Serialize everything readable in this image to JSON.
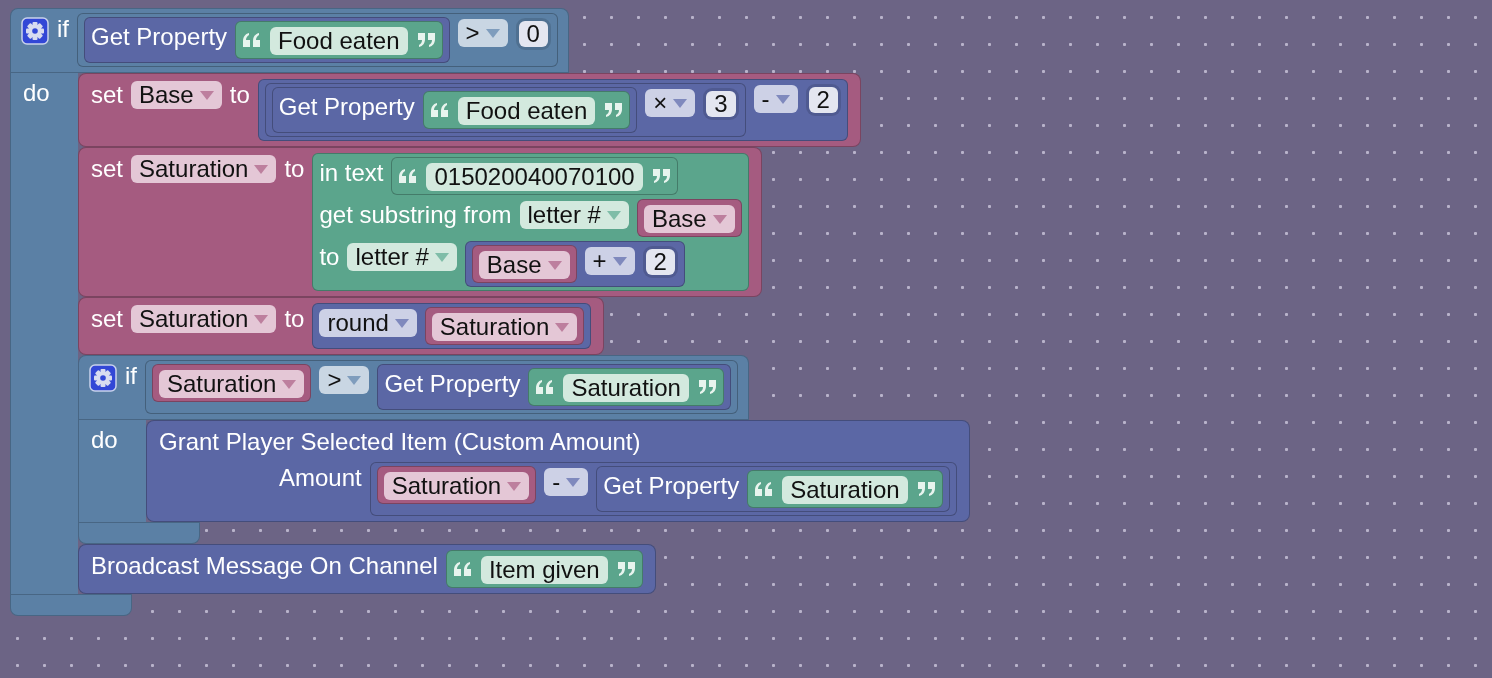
{
  "workspace": {
    "blocks": [
      {
        "kind": "logic",
        "rows": [
          {
            "parts": [
              {
                "kind": "gear"
              },
              {
                "kind": "label",
                "text": "if"
              },
              {
                "kind": "input",
                "block": {
                  "kind": "logic",
                  "rows": [
                    {
                      "parts": [
                        {
                          "kind": "input",
                          "block": {
                            "kind": "custom",
                            "rows": [
                              {
                                "parts": [
                                  {
                                    "kind": "label",
                                    "text": "Get Property"
                                  },
                                  {
                                    "kind": "input",
                                    "block": {
                                      "kind": "string",
                                      "rows": [
                                        {
                                          "parts": [
                                            {
                                              "kind": "field",
                                              "text": "Food eaten"
                                            }
                                          ]
                                        }
                                      ]
                                    }
                                  }
                                ]
                              }
                            ]
                          }
                        },
                        {
                          "kind": "dropdown",
                          "text": ">"
                        },
                        {
                          "kind": "number",
                          "text": "0"
                        }
                      ]
                    }
                  ]
                }
              }
            ]
          },
          {
            "parts": [
              {
                "kind": "label",
                "text": "do"
              }
            ],
            "statements": [
              {
                "kind": "variable",
                "rows": [
                  {
                    "parts": [
                      {
                        "kind": "label",
                        "text": "set"
                      },
                      {
                        "kind": "dropdown",
                        "text": "Base"
                      },
                      {
                        "kind": "label",
                        "text": "to"
                      },
                      {
                        "kind": "input",
                        "block": {
                          "kind": "math",
                          "rows": [
                            {
                              "parts": [
                                {
                                  "kind": "input",
                                  "block": {
                                    "kind": "math",
                                    "rows": [
                                      {
                                        "parts": [
                                          {
                                            "kind": "input",
                                            "block": {
                                              "kind": "custom",
                                              "rows": [
                                                {
                                                  "parts": [
                                                    {
                                                      "kind": "label",
                                                      "text": "Get Property"
                                                    },
                                                    {
                                                      "kind": "input",
                                                      "block": {
                                                        "kind": "string",
                                                        "rows": [
                                                          {
                                                            "parts": [
                                                              {
                                                                "kind": "field",
                                                                "text": "Food eaten"
                                                              }
                                                            ]
                                                          }
                                                        ]
                                                      }
                                                    }
                                                  ]
                                                }
                                              ]
                                            }
                                          },
                                          {
                                            "kind": "dropdown",
                                            "text": "×"
                                          },
                                          {
                                            "kind": "number",
                                            "text": "3"
                                          }
                                        ]
                                      }
                                    ]
                                  }
                                },
                                {
                                  "kind": "dropdown",
                                  "text": "-"
                                },
                                {
                                  "kind": "number",
                                  "text": "2"
                                }
                              ]
                            }
                          ]
                        }
                      }
                    ]
                  }
                ]
              },
              {
                "kind": "variable",
                "rows": [
                  {
                    "parts": [
                      {
                        "kind": "label",
                        "text": "set"
                      },
                      {
                        "kind": "dropdown",
                        "text": "Saturation"
                      },
                      {
                        "kind": "label",
                        "text": "to"
                      },
                      {
                        "kind": "input",
                        "block": {
                          "kind": "text",
                          "rows": [
                            {
                              "parts": [
                                {
                                  "kind": "label",
                                  "text": "in text"
                                },
                                {
                                  "kind": "input",
                                  "block": {
                                    "kind": "string",
                                    "rows": [
                                      {
                                        "parts": [
                                          {
                                            "kind": "field",
                                            "text": "015020040070100"
                                          }
                                        ]
                                      }
                                    ]
                                  }
                                }
                              ]
                            },
                            {
                              "parts": [
                                {
                                  "kind": "label",
                                  "text": "get substring from"
                                },
                                {
                                  "kind": "dropdown",
                                  "text": "letter #"
                                },
                                {
                                  "kind": "input",
                                  "block": {
                                    "kind": "variable",
                                    "rows": [
                                      {
                                        "parts": [
                                          {
                                            "kind": "dropdown",
                                            "text": "Base"
                                          }
                                        ]
                                      }
                                    ]
                                  }
                                }
                              ]
                            },
                            {
                              "parts": [
                                {
                                  "kind": "label",
                                  "text": "to"
                                },
                                {
                                  "kind": "dropdown",
                                  "text": "letter #"
                                },
                                {
                                  "kind": "input",
                                  "block": {
                                    "kind": "math",
                                    "rows": [
                                      {
                                        "parts": [
                                          {
                                            "kind": "input",
                                            "block": {
                                              "kind": "variable",
                                              "rows": [
                                                {
                                                  "parts": [
                                                    {
                                                      "kind": "dropdown",
                                                      "text": "Base"
                                                    }
                                                  ]
                                                }
                                              ]
                                            }
                                          },
                                          {
                                            "kind": "dropdown",
                                            "text": "+"
                                          },
                                          {
                                            "kind": "number",
                                            "text": "2"
                                          }
                                        ]
                                      }
                                    ]
                                  }
                                }
                              ]
                            }
                          ]
                        }
                      }
                    ]
                  }
                ]
              },
              {
                "kind": "variable",
                "rows": [
                  {
                    "parts": [
                      {
                        "kind": "label",
                        "text": "set"
                      },
                      {
                        "kind": "dropdown",
                        "text": "Saturation"
                      },
                      {
                        "kind": "label",
                        "text": "to"
                      },
                      {
                        "kind": "input",
                        "block": {
                          "kind": "math",
                          "rows": [
                            {
                              "parts": [
                                {
                                  "kind": "dropdown",
                                  "text": "round"
                                },
                                {
                                  "kind": "input",
                                  "block": {
                                    "kind": "variable",
                                    "rows": [
                                      {
                                        "parts": [
                                          {
                                            "kind": "dropdown",
                                            "text": "Saturation"
                                          }
                                        ]
                                      }
                                    ]
                                  }
                                }
                              ]
                            }
                          ]
                        }
                      }
                    ]
                  }
                ]
              },
              {
                "kind": "logic",
                "rows": [
                  {
                    "parts": [
                      {
                        "kind": "gear"
                      },
                      {
                        "kind": "label",
                        "text": "if"
                      },
                      {
                        "kind": "input",
                        "block": {
                          "kind": "logic",
                          "rows": [
                            {
                              "parts": [
                                {
                                  "kind": "input",
                                  "block": {
                                    "kind": "variable",
                                    "rows": [
                                      {
                                        "parts": [
                                          {
                                            "kind": "dropdown",
                                            "text": "Saturation"
                                          }
                                        ]
                                      }
                                    ]
                                  }
                                },
                                {
                                  "kind": "dropdown",
                                  "text": ">"
                                },
                                {
                                  "kind": "input",
                                  "block": {
                                    "kind": "custom",
                                    "rows": [
                                      {
                                        "parts": [
                                          {
                                            "kind": "label",
                                            "text": "Get Property"
                                          },
                                          {
                                            "kind": "input",
                                            "block": {
                                              "kind": "string",
                                              "rows": [
                                                {
                                                  "parts": [
                                                    {
                                                      "kind": "field",
                                                      "text": "Saturation"
                                                    }
                                                  ]
                                                }
                                              ]
                                            }
                                          }
                                        ]
                                      }
                                    ]
                                  }
                                }
                              ]
                            }
                          ]
                        }
                      }
                    ]
                  },
                  {
                    "parts": [
                      {
                        "kind": "label",
                        "text": "do"
                      }
                    ],
                    "statements": [
                      {
                        "kind": "custom",
                        "rows": [
                          {
                            "parts": [
                              {
                                "kind": "label",
                                "text": "Grant Player Selected Item (Custom Amount)"
                              }
                            ]
                          },
                          {
                            "parts": [
                              {
                                "kind": "label",
                                "text": "Amount"
                              },
                              {
                                "kind": "input",
                                "block": {
                                  "kind": "math",
                                  "rows": [
                                    {
                                      "parts": [
                                        {
                                          "kind": "input",
                                          "block": {
                                            "kind": "variable",
                                            "rows": [
                                              {
                                                "parts": [
                                                  {
                                                    "kind": "dropdown",
                                                    "text": "Saturation"
                                                  }
                                                ]
                                              }
                                            ]
                                          }
                                        },
                                        {
                                          "kind": "dropdown",
                                          "text": "-"
                                        },
                                        {
                                          "kind": "input",
                                          "block": {
                                            "kind": "custom",
                                            "rows": [
                                              {
                                                "parts": [
                                                  {
                                                    "kind": "label",
                                                    "text": "Get Property"
                                                  },
                                                  {
                                                    "kind": "input",
                                                    "block": {
                                                      "kind": "string",
                                                      "rows": [
                                                        {
                                                          "parts": [
                                                            {
                                                              "kind": "field",
                                                              "text": "Saturation"
                                                            }
                                                          ]
                                                        }
                                                      ]
                                                    }
                                                  }
                                                ]
                                              }
                                            ]
                                          }
                                        }
                                      ]
                                    }
                                  ]
                                }
                              }
                            ]
                          }
                        ]
                      }
                    ]
                  }
                ]
              },
              {
                "kind": "custom",
                "rows": [
                  {
                    "parts": [
                      {
                        "kind": "label",
                        "text": "Broadcast Message On Channel"
                      },
                      {
                        "kind": "input",
                        "block": {
                          "kind": "string",
                          "rows": [
                            {
                              "parts": [
                                {
                                  "kind": "field",
                                  "text": "Item given"
                                }
                              ]
                            }
                          ]
                        }
                      }
                    ]
                  }
                ]
              }
            ]
          }
        ]
      }
    ]
  }
}
